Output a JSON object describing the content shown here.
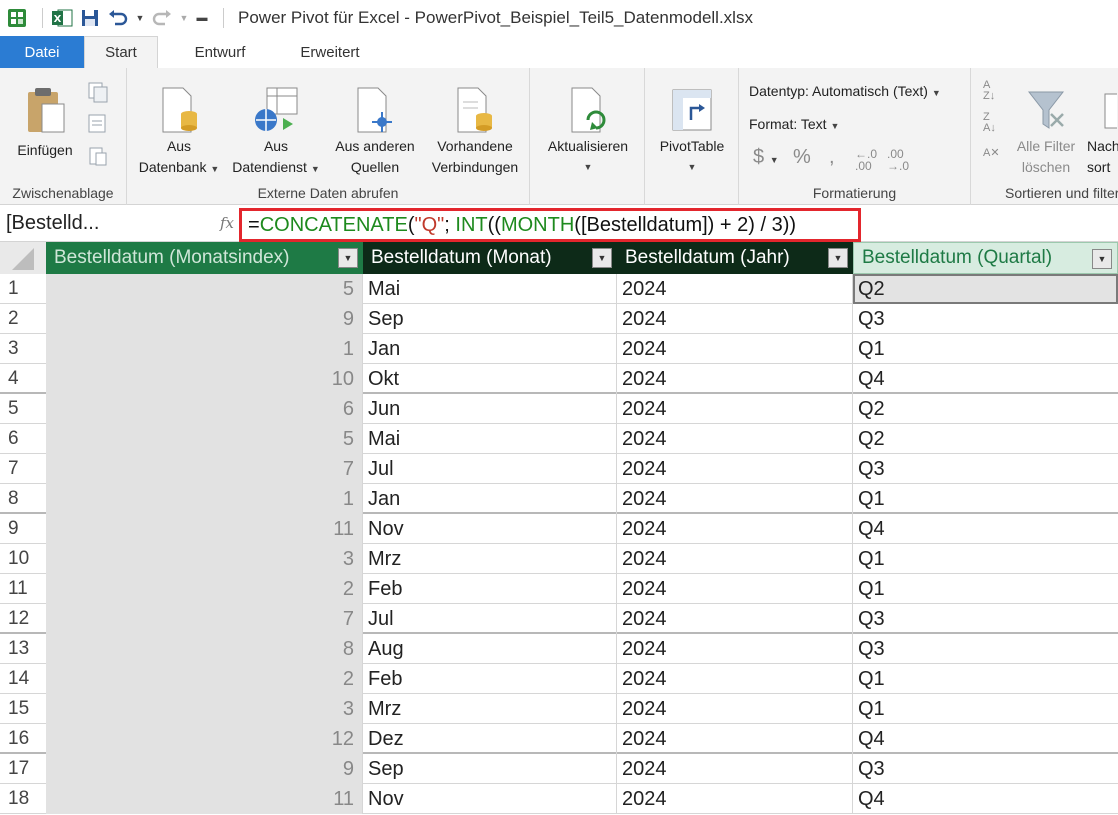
{
  "window": {
    "title": "Power Pivot für Excel - PowerPivot_Beispiel_Teil5_Datenmodell.xlsx"
  },
  "quick_access": {
    "icons": [
      "powerpivot-icon",
      "excel-icon",
      "save-icon",
      "undo-icon",
      "redo-icon",
      "customize-icon"
    ]
  },
  "tabs": [
    "Datei",
    "Start",
    "Entwurf",
    "Erweitert"
  ],
  "ribbon": {
    "clipboard": {
      "paste": "Einfügen",
      "label": "Zwischenablage"
    },
    "external": {
      "db_line1": "Aus",
      "db_line2": "Datenbank",
      "svc_line1": "Aus",
      "svc_line2": "Datendienst",
      "other_line1": "Aus anderen",
      "other_line2": "Quellen",
      "existing_line1": "Vorhandene",
      "existing_line2": "Verbindungen",
      "label": "Externe Daten abrufen"
    },
    "refresh": {
      "label": "Aktualisieren"
    },
    "pivot": {
      "label": "PivotTable"
    },
    "formatting": {
      "datatype": "Datentyp: Automatisch (Text)",
      "format": "Format: Text",
      "label": "Formatierung"
    },
    "sort": {
      "clear_line1": "Alle Filter",
      "clear_line2": "löschen",
      "sortby_line1": "Nach",
      "sortby_line2": "sort",
      "label": "Sortieren und filtern"
    }
  },
  "formula_bar": {
    "name_box": "[Bestelld...",
    "fx": "fx",
    "formula": {
      "eq": "=",
      "fn1": "CONCATENATE",
      "p1": "(",
      "str": "\"Q\"",
      "p2": "; ",
      "fn2": "INT",
      "p3": "((",
      "fn3": "MONTH",
      "p4": "([Bestelldatum]) + 2) / 3))"
    }
  },
  "table": {
    "columns": [
      "Bestelldatum (Monatsindex)",
      "Bestelldatum (Monat)",
      "Bestelldatum (Jahr)",
      "Bestelldatum (Quartal)"
    ],
    "rows": [
      [
        "1",
        "5",
        "Mai",
        "2024",
        "Q2"
      ],
      [
        "2",
        "9",
        "Sep",
        "2024",
        "Q3"
      ],
      [
        "3",
        "1",
        "Jan",
        "2024",
        "Q1"
      ],
      [
        "4",
        "10",
        "Okt",
        "2024",
        "Q4"
      ],
      [
        "5",
        "6",
        "Jun",
        "2024",
        "Q2"
      ],
      [
        "6",
        "5",
        "Mai",
        "2024",
        "Q2"
      ],
      [
        "7",
        "7",
        "Jul",
        "2024",
        "Q3"
      ],
      [
        "8",
        "1",
        "Jan",
        "2024",
        "Q1"
      ],
      [
        "9",
        "11",
        "Nov",
        "2024",
        "Q4"
      ],
      [
        "10",
        "3",
        "Mrz",
        "2024",
        "Q1"
      ],
      [
        "11",
        "2",
        "Feb",
        "2024",
        "Q1"
      ],
      [
        "12",
        "7",
        "Jul",
        "2024",
        "Q3"
      ],
      [
        "13",
        "8",
        "Aug",
        "2024",
        "Q3"
      ],
      [
        "14",
        "2",
        "Feb",
        "2024",
        "Q1"
      ],
      [
        "15",
        "3",
        "Mrz",
        "2024",
        "Q1"
      ],
      [
        "16",
        "12",
        "Dez",
        "2024",
        "Q4"
      ],
      [
        "17",
        "9",
        "Sep",
        "2024",
        "Q3"
      ],
      [
        "18",
        "11",
        "Nov",
        "2024",
        "Q4"
      ]
    ]
  },
  "colors": {
    "file_tab": "#2b7cd3",
    "header_dark": "#0d2a18",
    "header_green": "#1e7a45",
    "formula_highlight": "#e3262d"
  }
}
